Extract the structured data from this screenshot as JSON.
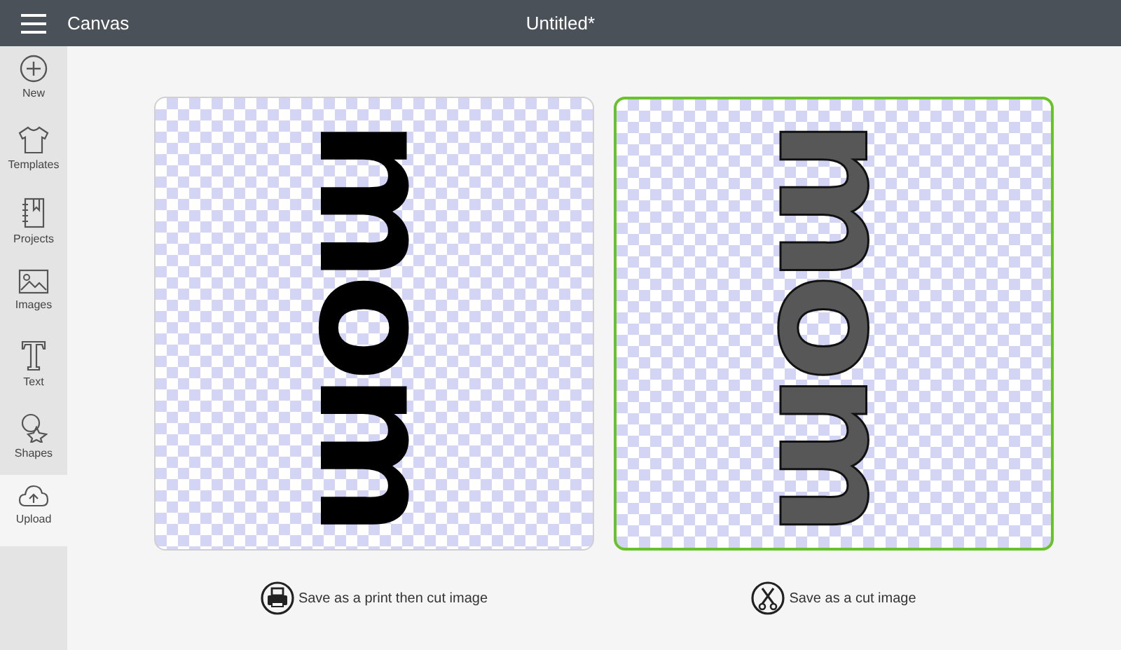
{
  "header": {
    "title": "Canvas",
    "document": "Untitled*"
  },
  "sidebar": {
    "items": [
      {
        "label": "New",
        "kind": "new",
        "selected": false
      },
      {
        "label": "Templates",
        "kind": "templates",
        "selected": false
      },
      {
        "label": "Projects",
        "kind": "projects",
        "selected": false
      },
      {
        "label": "Images",
        "kind": "images",
        "selected": false
      },
      {
        "label": "Text",
        "kind": "text",
        "selected": false
      },
      {
        "label": "Shapes",
        "kind": "shapes",
        "selected": false
      },
      {
        "label": "Upload",
        "kind": "upload",
        "selected": true
      }
    ]
  },
  "previews": [
    {
      "kind": "print",
      "artwork": "mom",
      "selected": false,
      "option": "Save as a print then cut image"
    },
    {
      "kind": "cut",
      "artwork": "mom",
      "selected": true,
      "option": "Save as a cut image"
    }
  ]
}
